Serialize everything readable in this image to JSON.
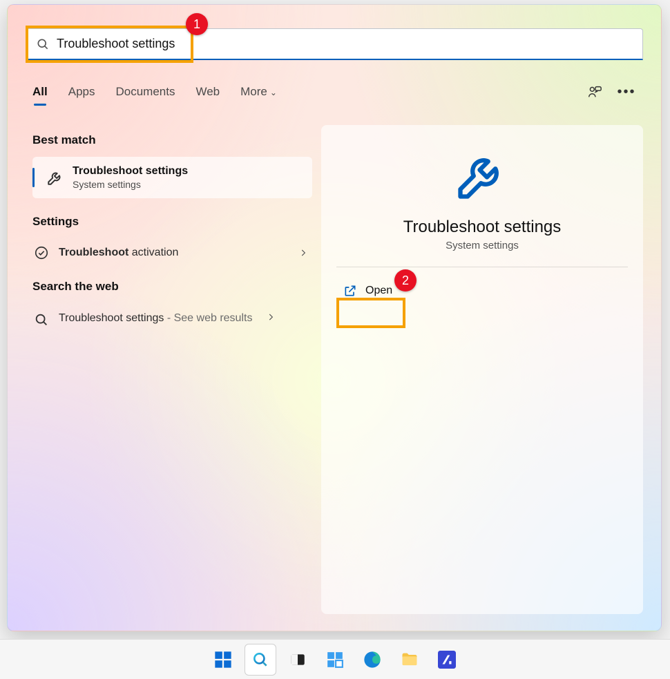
{
  "annotations": {
    "step1": "1",
    "step2": "2"
  },
  "search": {
    "query": "Troubleshoot settings"
  },
  "tabs": {
    "all": "All",
    "apps": "Apps",
    "documents": "Documents",
    "web": "Web",
    "more": "More"
  },
  "left": {
    "best_match_h": "Best match",
    "best_match": {
      "title": "Troubleshoot settings",
      "subtitle": "System settings"
    },
    "settings_h": "Settings",
    "settings_item": {
      "bold": "Troubleshoot",
      "rest": " activation"
    },
    "web_h": "Search the web",
    "web_item": {
      "title": "Troubleshoot settings",
      "suffix": " - See web results"
    }
  },
  "preview": {
    "title": "Troubleshoot settings",
    "subtitle": "System settings",
    "open": "Open"
  },
  "colors": {
    "accent": "#005fba",
    "highlight": "#f5a100",
    "badge": "#e81123"
  }
}
